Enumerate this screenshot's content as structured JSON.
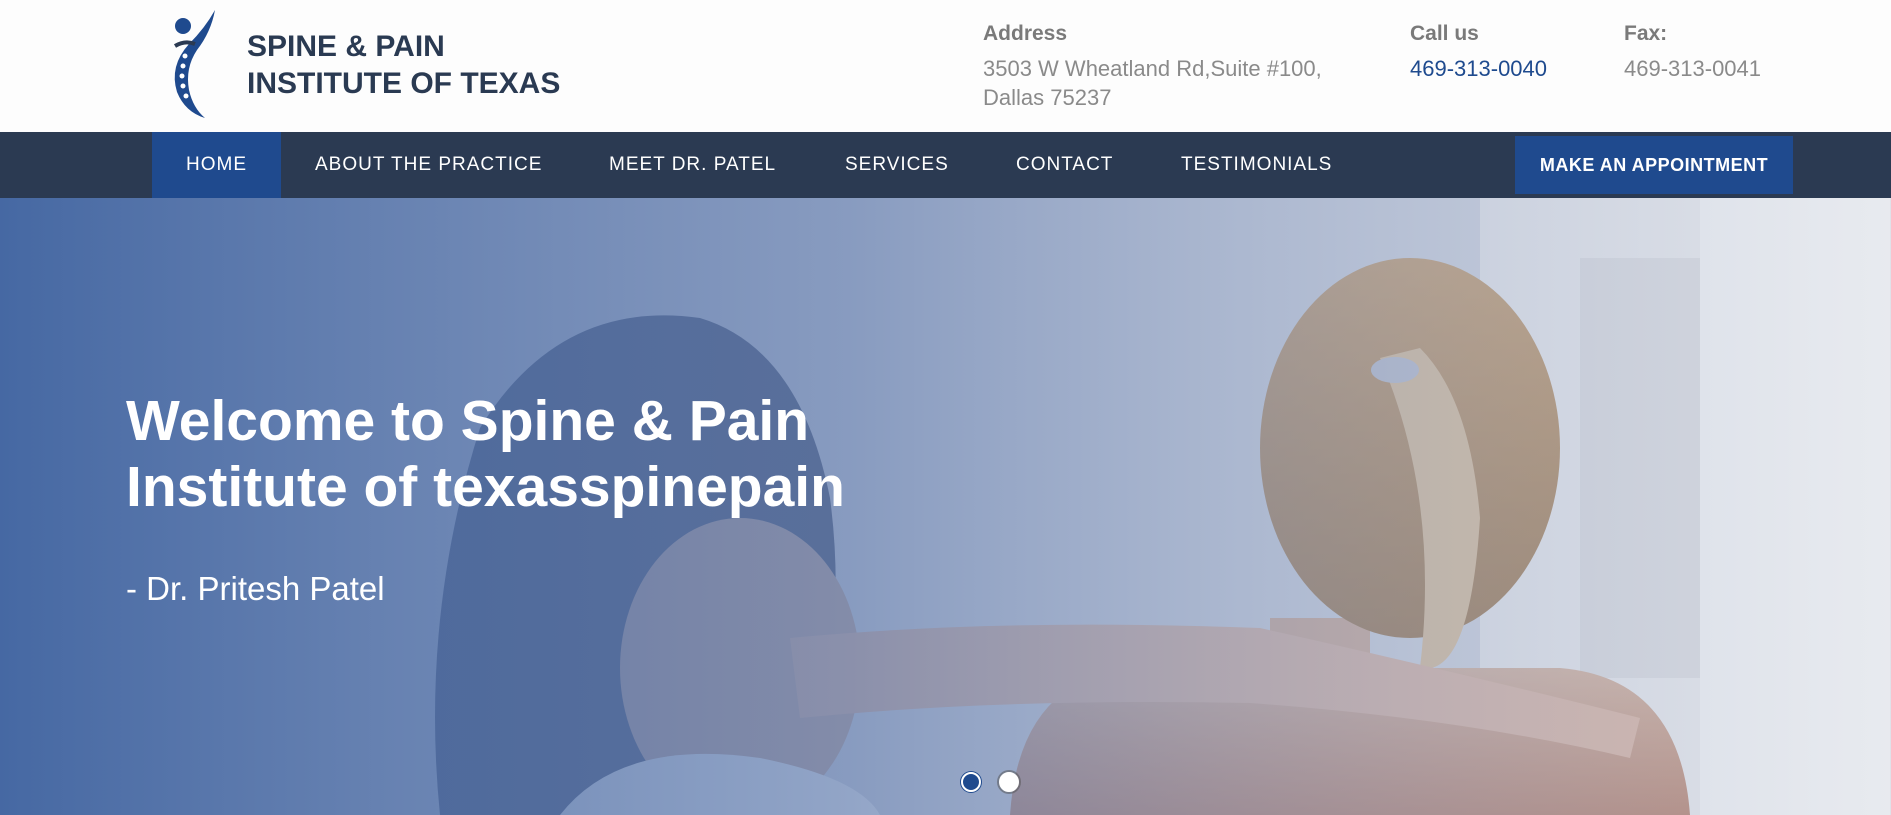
{
  "brand": {
    "line1": "SPINE & PAIN",
    "line2": "INSTITUTE OF TEXAS",
    "logo_icon": "spine-figure-icon"
  },
  "contact": {
    "address_label": "Address",
    "address_line1": "3503 W Wheatland Rd,Suite #100,",
    "address_line2": "Dallas 75237",
    "call_label": "Call us",
    "call_value": "469-313-0040",
    "fax_label": "Fax:",
    "fax_value": "469-313-0041"
  },
  "nav": {
    "items": [
      {
        "label": "HOME",
        "active": true
      },
      {
        "label": "ABOUT THE PRACTICE"
      },
      {
        "label": "MEET DR. PATEL"
      },
      {
        "label": "SERVICES"
      },
      {
        "label": "CONTACT"
      },
      {
        "label": "TESTIMONIALS"
      }
    ],
    "appointment_label": "MAKE AN APPOINTMENT"
  },
  "hero": {
    "title_line1": "Welcome to Spine & Pain",
    "title_line2": "Institute of texasspinepain",
    "subtitle": "- Dr. Pritesh Patel",
    "slides": 2,
    "active_slide": 1
  },
  "colors": {
    "navy": "#2b3a52",
    "accent_blue": "#1f4a8e",
    "text_gray": "#8a8a8a"
  }
}
